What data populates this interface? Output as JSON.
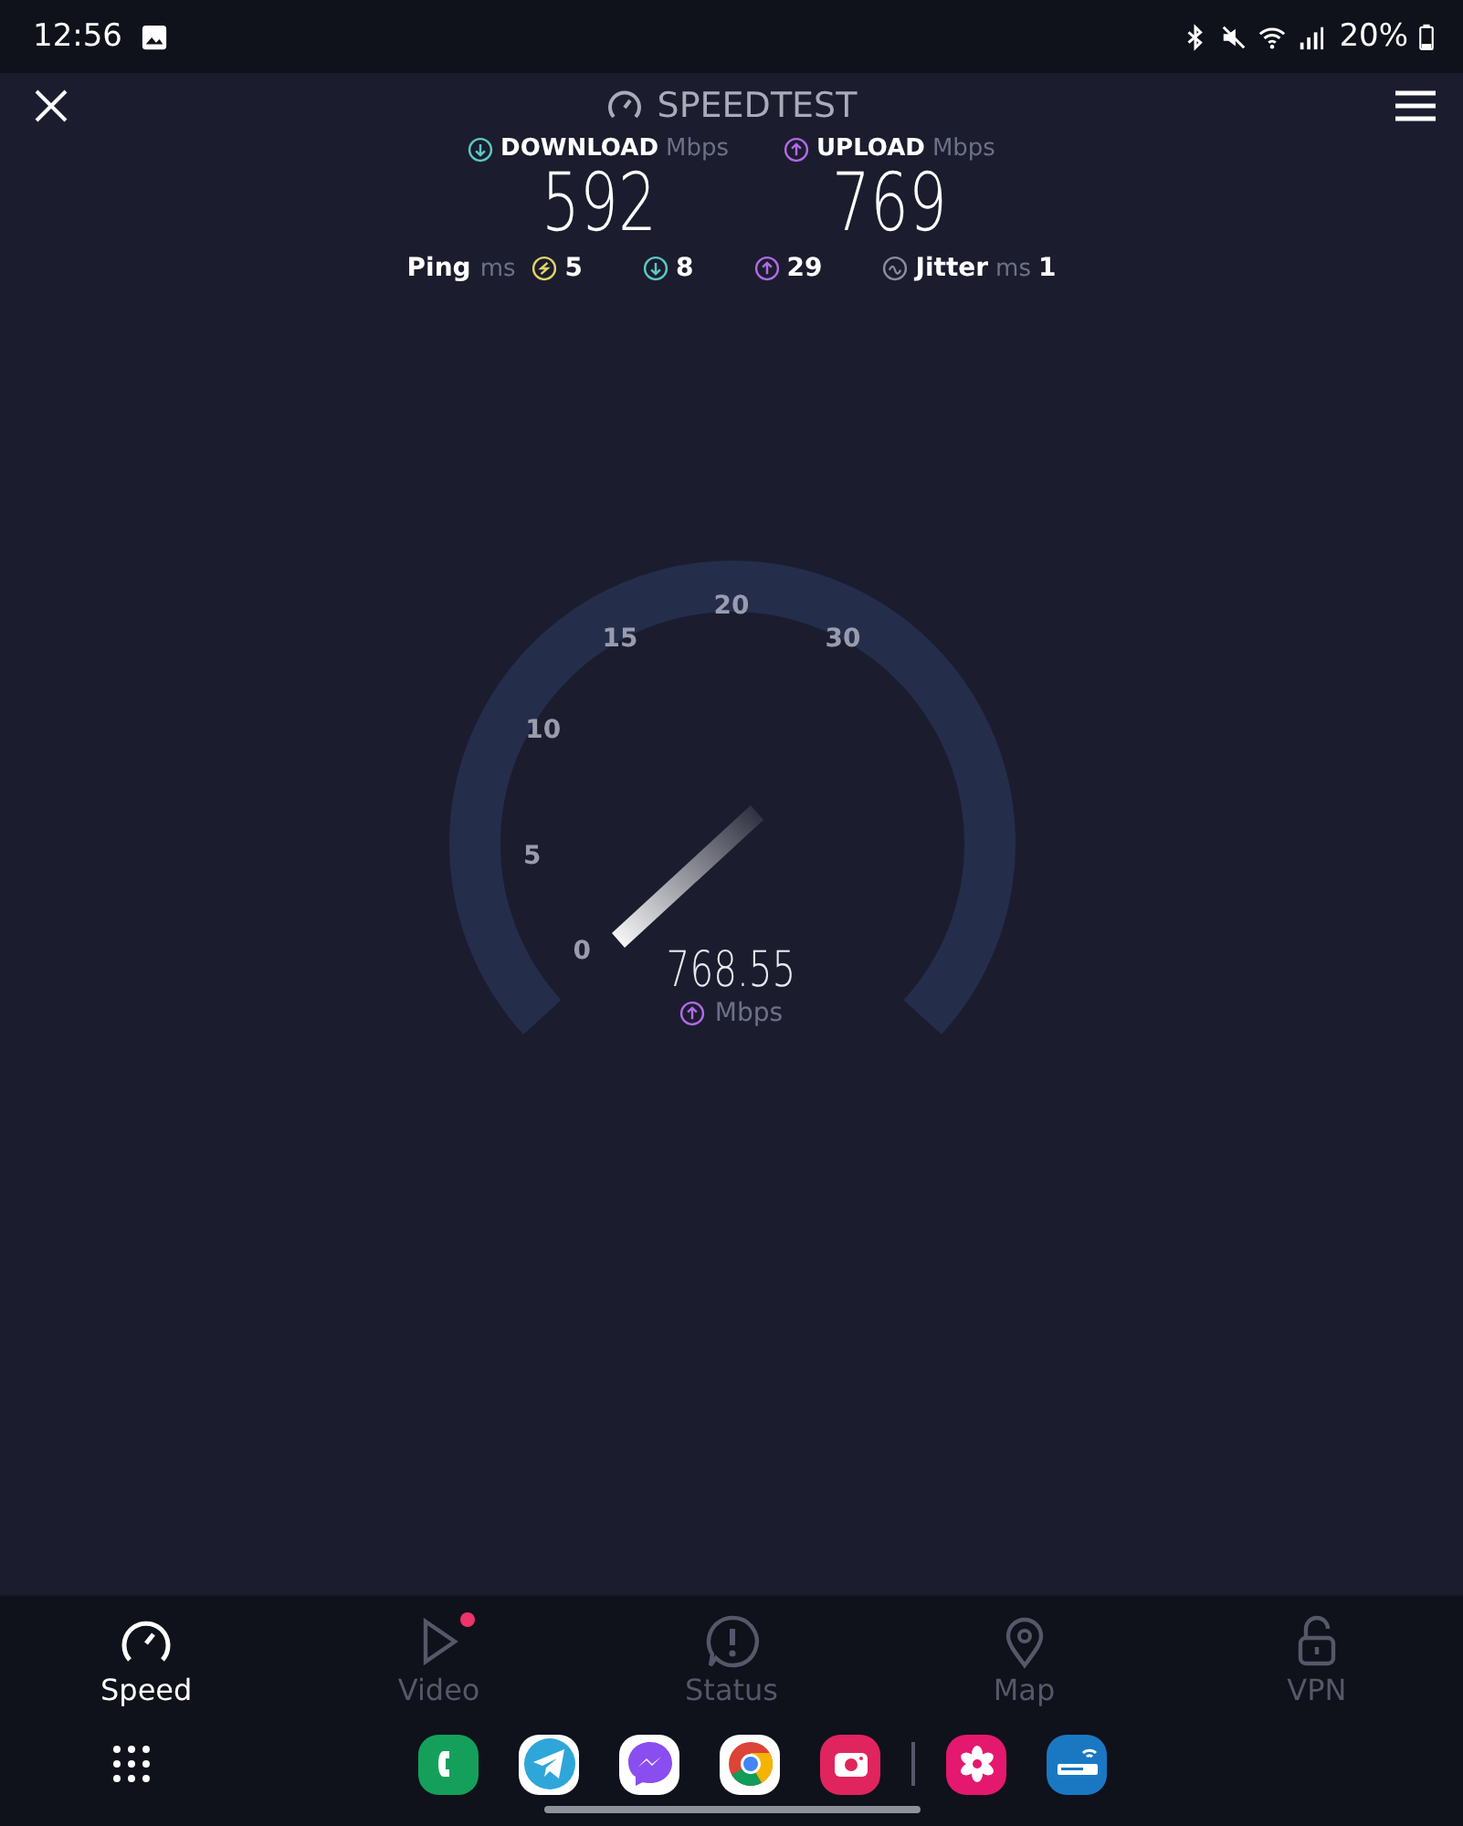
{
  "status_bar": {
    "time": "12:56",
    "battery": "20%"
  },
  "header": {
    "title": "SPEEDTEST"
  },
  "results": [
    {
      "kind": "download",
      "label": "DOWNLOAD",
      "unit": "Mbps",
      "value": "592"
    },
    {
      "kind": "upload",
      "label": "UPLOAD",
      "unit": "Mbps",
      "value": "769"
    }
  ],
  "latency": {
    "ping_label": "Ping",
    "ping_unit": "ms",
    "items": [
      {
        "kind": "idle",
        "value": "5"
      },
      {
        "kind": "download",
        "value": "8"
      },
      {
        "kind": "upload",
        "value": "29"
      }
    ],
    "jitter_label": "Jitter",
    "jitter_unit": "ms",
    "jitter_value": "1"
  },
  "gauge": {
    "scale": [
      "0",
      "5",
      "10",
      "15",
      "20",
      "30"
    ],
    "reading": "768.55",
    "unit": "Mbps",
    "kind": "upload"
  },
  "nav": [
    {
      "kind": "speed",
      "label": "Speed",
      "selected": true,
      "notification": false
    },
    {
      "kind": "video",
      "label": "Video",
      "selected": false,
      "notification": true
    },
    {
      "kind": "status",
      "label": "Status",
      "selected": false,
      "notification": false
    },
    {
      "kind": "map",
      "label": "Map",
      "selected": false,
      "notification": false
    },
    {
      "kind": "vpn",
      "label": "VPN",
      "selected": false,
      "notification": false
    }
  ]
}
